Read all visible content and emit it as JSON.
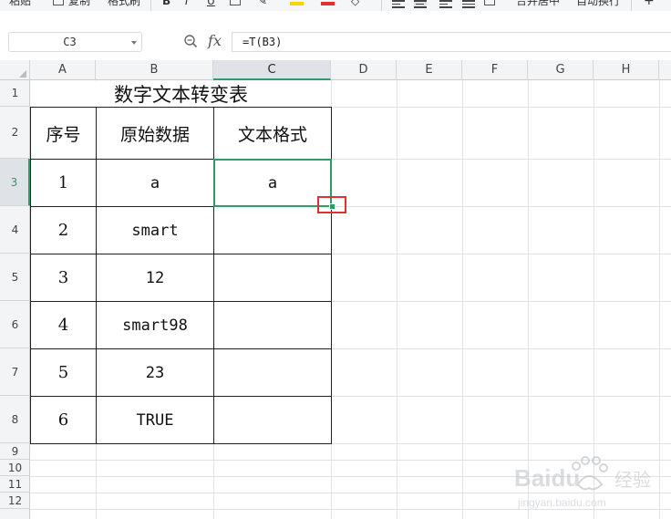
{
  "ribbon": {
    "paste_label": "粘贴",
    "copy_label": "复制",
    "format_painter_label": "格式刷",
    "merge_center_label": "合并居中",
    "wrap_text_label": "自动换行",
    "font_color": "#e0312d",
    "highlight_color": "#f6d500"
  },
  "formula_bar": {
    "name_box": "C3",
    "fx_label": "fx",
    "formula": "=T(B3)"
  },
  "columns": [
    "A",
    "B",
    "C",
    "D",
    "E",
    "F",
    "G",
    "H"
  ],
  "rows": [
    "1",
    "2",
    "3",
    "4",
    "5",
    "6",
    "7",
    "8",
    "9",
    "10",
    "11",
    "12"
  ],
  "active_cell": "C3",
  "sheet": {
    "title": "数字文本转变表",
    "headers": [
      "序号",
      "原始数据",
      "文本格式"
    ],
    "records": [
      {
        "index": "1",
        "original": "a",
        "text": "a"
      },
      {
        "index": "2",
        "original": "smart",
        "text": ""
      },
      {
        "index": "3",
        "original": "12",
        "text": ""
      },
      {
        "index": "4",
        "original": "smart98",
        "text": ""
      },
      {
        "index": "5",
        "original": "23",
        "text": ""
      },
      {
        "index": "6",
        "original": "TRUE",
        "text": ""
      }
    ]
  },
  "colors": {
    "selection": "#2e9c64",
    "annotation": "#e0312d",
    "gridline": "#dfe1e5"
  },
  "watermark": {
    "brand": "Baidu",
    "suffix": "经验",
    "url": "jingyan.baidu.com"
  }
}
